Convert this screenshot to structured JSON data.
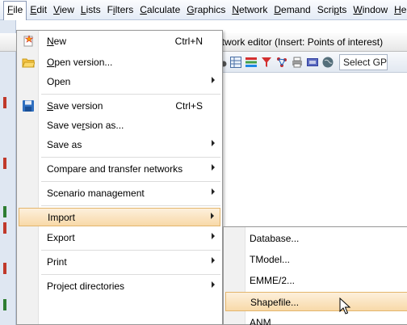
{
  "menubar": {
    "items": [
      {
        "label": "File",
        "mnemonic": "F",
        "rest": "ile"
      },
      {
        "label": "Edit",
        "mnemonic": "E",
        "rest": "dit"
      },
      {
        "label": "View",
        "mnemonic": "V",
        "rest": "iew"
      },
      {
        "label": "Lists",
        "mnemonic": "L",
        "rest": "ists"
      },
      {
        "label": "Filters",
        "pre": "F",
        "mnemonic": "i",
        "rest": "lters"
      },
      {
        "label": "Calculate",
        "mnemonic": "C",
        "rest": "alculate"
      },
      {
        "label": "Graphics",
        "mnemonic": "G",
        "rest": "raphics"
      },
      {
        "label": "Network",
        "mnemonic": "N",
        "rest": "etwork"
      },
      {
        "label": "Demand",
        "mnemonic": "D",
        "rest": "emand"
      },
      {
        "label": "Scripts",
        "pre": "Scri",
        "mnemonic": "p",
        "rest": "ts"
      },
      {
        "label": "Window",
        "mnemonic": "W",
        "rest": "indow"
      },
      {
        "label": "Help",
        "mnemonic": "H",
        "rest": "elp"
      }
    ]
  },
  "window": {
    "title": "etwork editor (Insert: Points of interest)"
  },
  "toolbar": {
    "select_placeholder": "Select GPar",
    "icons": [
      "binoculars-icon",
      "table-icon",
      "colors-icon",
      "filter-icon",
      "network-icon",
      "print-icon",
      "screenshot-icon",
      "globe-icon"
    ]
  },
  "file_menu": {
    "items": [
      {
        "type": "item",
        "label": "New",
        "mnemonic_index": 0,
        "shortcut": "Ctrl+N",
        "icon": "new-icon"
      },
      {
        "type": "item",
        "label": "Open version...",
        "mnemonic_index": 0,
        "shortcut": "",
        "icon": "open-folder-icon"
      },
      {
        "type": "submenu",
        "label": "Open"
      },
      {
        "type": "separator"
      },
      {
        "type": "item",
        "label": "Save version",
        "mnemonic_index": 0,
        "shortcut": "Ctrl+S",
        "icon": "save-icon"
      },
      {
        "type": "item",
        "label": "Save version as...",
        "mnemonic_index": 7,
        "shortcut": ""
      },
      {
        "type": "submenu",
        "label": "Save as"
      },
      {
        "type": "separator"
      },
      {
        "type": "submenu",
        "label": "Compare and transfer networks"
      },
      {
        "type": "separator"
      },
      {
        "type": "submenu",
        "label": "Scenario management"
      },
      {
        "type": "separator"
      },
      {
        "type": "submenu",
        "label": "Import",
        "highlighted": true
      },
      {
        "type": "submenu",
        "label": "Export"
      },
      {
        "type": "separator"
      },
      {
        "type": "submenu",
        "label": "Print"
      },
      {
        "type": "separator"
      },
      {
        "type": "submenu",
        "label": "Project directories"
      }
    ]
  },
  "import_submenu": {
    "items": [
      {
        "label": "Database..."
      },
      {
        "label": "TModel..."
      },
      {
        "label": "EMME/2..."
      },
      {
        "label": "Shapefile...",
        "highlighted": true
      },
      {
        "label": "ANM"
      }
    ]
  },
  "colors": {
    "highlight_top": "#fdf0dc",
    "highlight_bottom": "#f8d9a8",
    "highlight_border": "#e3b56c",
    "menubar_bg": "#e4ebf6"
  }
}
